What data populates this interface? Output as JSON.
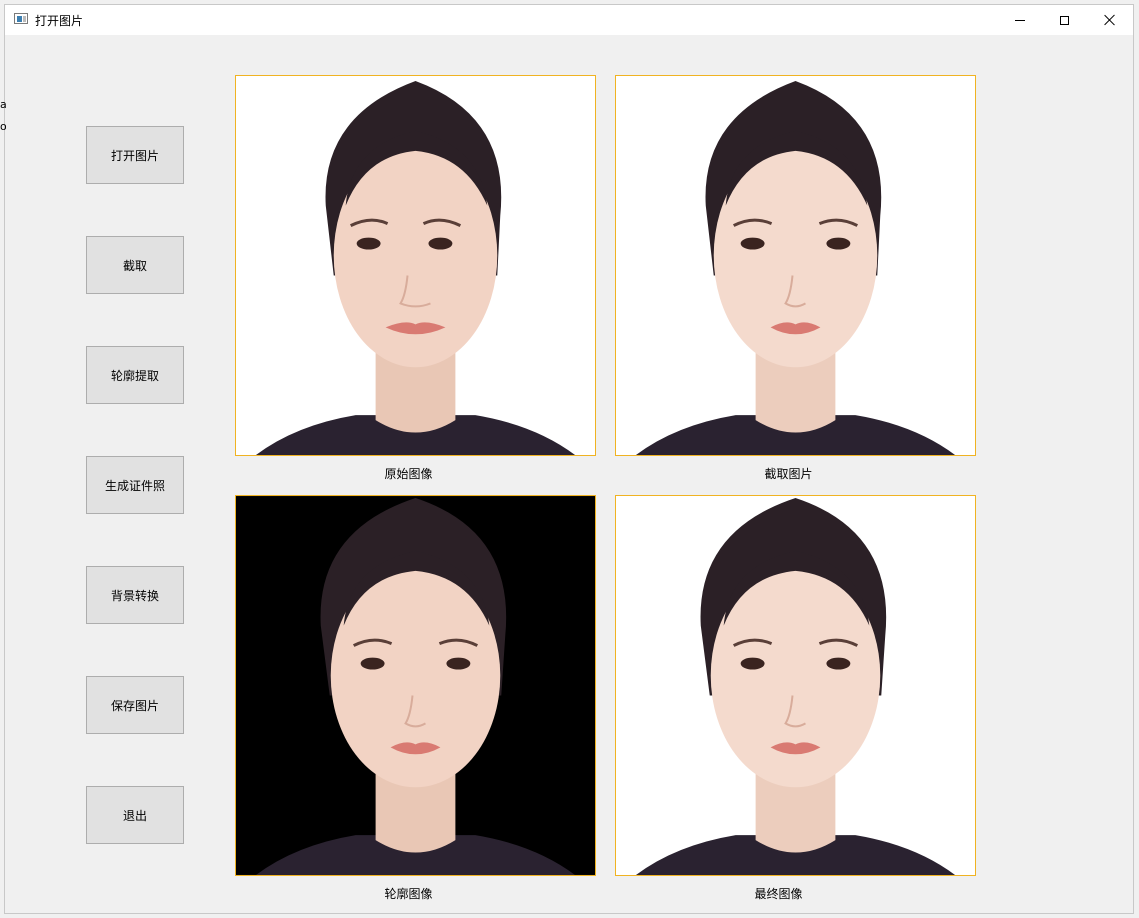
{
  "window": {
    "title": "打开图片",
    "icon": "app-window-icon",
    "controls": [
      "minimize-icon",
      "maximize-icon",
      "close-icon"
    ]
  },
  "stray_text": [
    "ac",
    "o"
  ],
  "buttons": {
    "open": "打开图片",
    "crop": "截取",
    "contour": "轮廓提取",
    "id_photo": "生成证件照",
    "background": "背景转换",
    "save": "保存图片",
    "exit": "退出"
  },
  "panels": {
    "original": "原始图像",
    "cropped": "截取图片",
    "contour": "轮廓图像",
    "final": "最终图像"
  },
  "colors": {
    "frame_border": "#f0b322",
    "button_bg": "#e1e1e1",
    "window_bg": "#f0f0f0"
  }
}
